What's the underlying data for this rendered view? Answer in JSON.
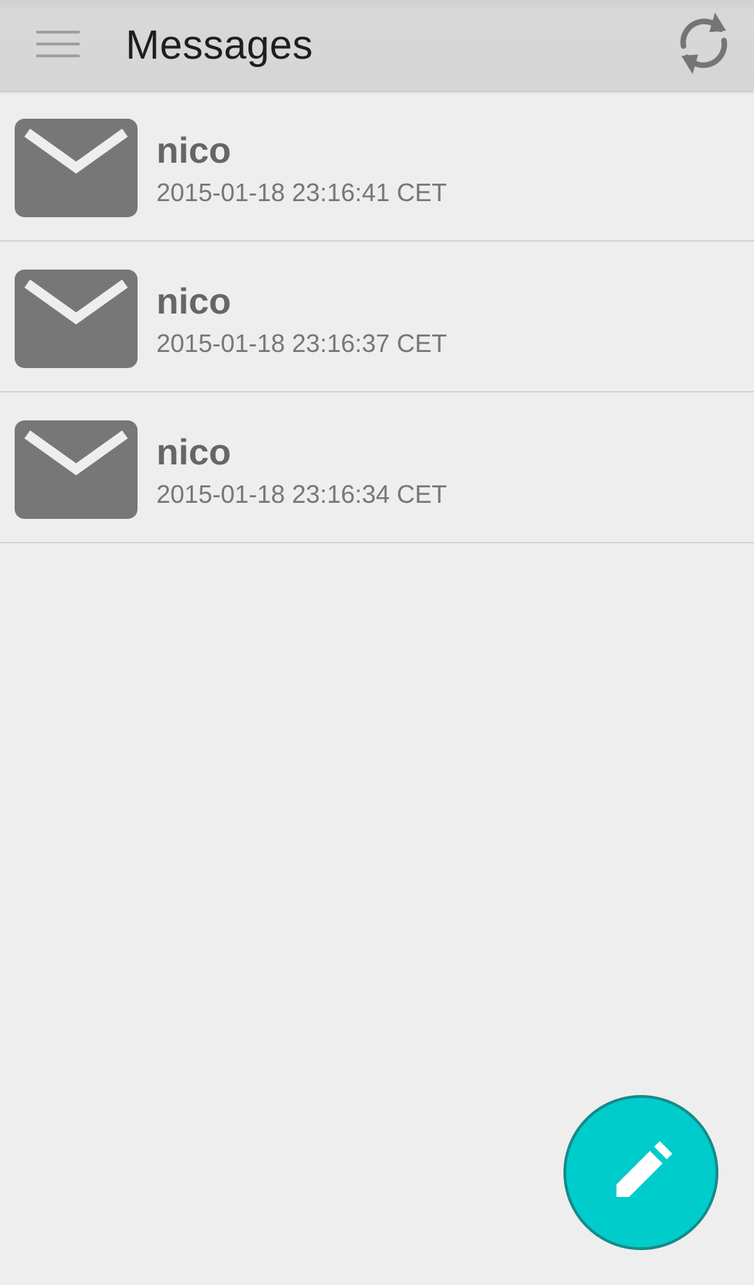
{
  "app_bar": {
    "title": "Messages",
    "menu_icon": "hamburger-menu-icon",
    "refresh_icon": "refresh-icon"
  },
  "messages": [
    {
      "sender": "nico",
      "timestamp": "2015-01-18 23:16:41 CET",
      "icon": "envelope-icon"
    },
    {
      "sender": "nico",
      "timestamp": "2015-01-18 23:16:37 CET",
      "icon": "envelope-icon"
    },
    {
      "sender": "nico",
      "timestamp": "2015-01-18 23:16:34 CET",
      "icon": "envelope-icon"
    }
  ],
  "fab": {
    "icon": "pencil-icon",
    "color": "#00cccc"
  },
  "colors": {
    "background": "#eeeeee",
    "app_bar": "#d6d6d6",
    "icon_gray": "#777777"
  }
}
